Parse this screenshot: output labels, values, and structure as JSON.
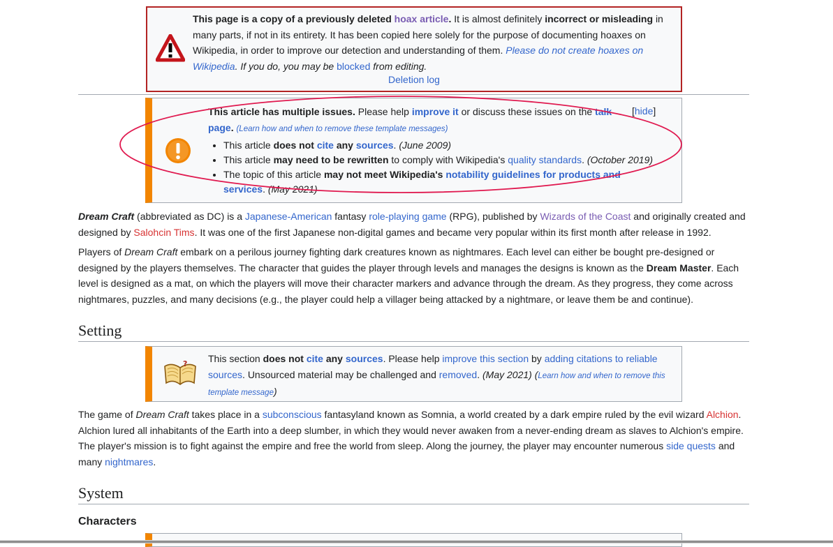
{
  "hoax": {
    "bold1": "This page is a copy of a previously deleted",
    "link1": "hoax article",
    "text1": "It is almost definitely",
    "bold2": "incorrect or misleading",
    "text2": "in many parts, if not in its entirety. It has been copied here solely for the purpose of documenting hoaxes on Wikipedia, in order to improve our detection and understanding of them.",
    "link2": "Please do not create hoaxes on Wikipedia",
    "text3": "If you do, you may be",
    "link3": "blocked",
    "text4": "from editing.",
    "deletion_log": "Deletion log"
  },
  "issues": {
    "title": "This article has multiple issues.",
    "text1": "Please help",
    "link_improve": "improve it",
    "text2": "or discuss these issues on the",
    "link_talk": "talk page",
    "learn": "(Learn how and when to remove these template messages)",
    "hide": "hide",
    "items": [
      {
        "t1": "This article",
        "b1": "does not",
        "l1": "cite",
        "b2": "any",
        "l2": "sources",
        "t2": "(June 2009)"
      },
      {
        "t1": "This article",
        "b1": "may need to be rewritten",
        "t2": "to comply with Wikipedia's",
        "l1": "quality standards",
        "t3": "(October 2019)"
      },
      {
        "t1": "The topic of this article",
        "b1": "may not meet Wikipedia's",
        "l1": "notability guidelines for products and services",
        "t2": "(May 2021)"
      }
    ]
  },
  "intro": {
    "title_italic": "Dream Craft",
    "t1": "(abbreviated as DC) is a",
    "link1": "Japanese-American",
    "t2": "fantasy",
    "link2": "role-playing game",
    "t3": "(RPG), published by",
    "link3": "Wizards of the Coast",
    "t4": "and originally created and designed by",
    "link4": "Salohcin Tims",
    "t5": "It was one of the first Japanese non-digital games and became very popular within its first month after release in 1992."
  },
  "para2": {
    "t1": "Players of",
    "i1": "Dream Craft",
    "t2": "embark on a perilous journey fighting dark creatures known as nightmares. Each level can either be bought pre-designed or designed by the players themselves. The character that guides the player through levels and manages the designs is known as the",
    "b1": "Dream Master",
    "t3": "Each level is designed as a mat, on which the players will move their character markers and advance through the dream. As they progress, they come across nightmares, puzzles, and many decisions (e.g., the player could help a villager being attacked by a nightmare, or leave them be and continue)."
  },
  "setting": {
    "heading": "Setting",
    "box": {
      "t1": "This section",
      "b1": "does not",
      "l1": "cite",
      "b2": "any",
      "l2": "sources",
      "t2": "Please help",
      "l3": "improve this section",
      "t3": "by",
      "l4": "adding citations to reliable sources",
      "t4": "Unsourced material may be challenged and",
      "l5": "removed",
      "date": "(May 2021)",
      "learn": "Learn how and when to remove this template message"
    },
    "para": {
      "t1": "The game of",
      "i1": "Dream Craft",
      "t2": "takes place in a",
      "l1": "subconscious",
      "t3": "fantasyland known as Somnia, a world created by a dark empire ruled by the evil wizard",
      "l2": "Alchion",
      "t4": "Alchion lured all inhabitants of the Earth into a deep slumber, in which they would never awaken from a never-ending dream as slaves to Alchion's empire. The player's mission is to fight against the empire and free the world from sleep. Along the journey, the player may encounter numerous",
      "l3": "side quests",
      "t5": "and many",
      "l4": "nightmares"
    }
  },
  "system": {
    "heading": "System",
    "subheading": "Characters"
  },
  "icons": {
    "hoax": "warning-triangle-icon",
    "issues": "exclamation-circle-icon",
    "section": "open-book-icon"
  }
}
